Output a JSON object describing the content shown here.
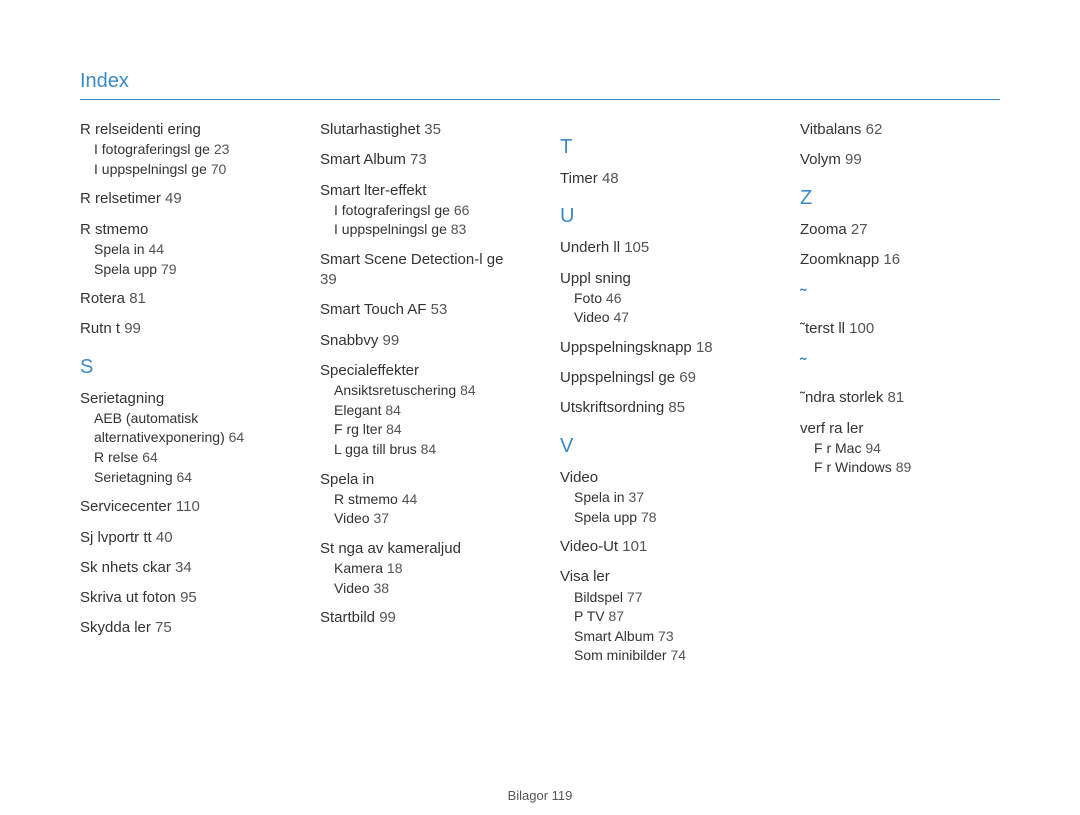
{
  "title": "Index",
  "footer_label": "Bilagor",
  "footer_page": "119",
  "columns": [
    {
      "blocks": [
        {
          "entries": [
            {
              "label": "R relseidenti ering",
              "subs": [
                {
                  "label": "I fotograferingsl ge",
                  "page": "23"
                },
                {
                  "label": "I uppspelningsl ge",
                  "page": "70"
                }
              ]
            },
            {
              "label": "R relsetimer",
              "page": "49"
            },
            {
              "label": "R stmemo",
              "subs": [
                {
                  "label": "Spela in",
                  "page": "44"
                },
                {
                  "label": "Spela upp",
                  "page": "79"
                }
              ]
            },
            {
              "label": "Rotera",
              "page": "81"
            },
            {
              "label": "Rutn t",
              "page": "99"
            }
          ]
        },
        {
          "letter": "S",
          "entries": [
            {
              "label": "Serietagning",
              "subs": [
                {
                  "label": "AEB (automatisk alternativexponering)",
                  "page": "64"
                },
                {
                  "label": "R relse",
                  "page": "64"
                },
                {
                  "label": "Serietagning",
                  "page": "64"
                }
              ]
            },
            {
              "label": "Servicecenter",
              "page": "110"
            },
            {
              "label": "Sj lvportr tt",
              "page": "40"
            },
            {
              "label": "Sk nhets ckar",
              "page": "34"
            },
            {
              "label": "Skriva ut foton",
              "page": "95"
            },
            {
              "label": "Skydda  ler",
              "page": "75"
            }
          ]
        }
      ]
    },
    {
      "blocks": [
        {
          "entries": [
            {
              "label": "Slutarhastighet",
              "page": "35"
            },
            {
              "label": "Smart Album",
              "page": "73"
            },
            {
              "label": "Smart  lter-effekt",
              "subs": [
                {
                  "label": "I fotograferingsl ge",
                  "page": "66"
                },
                {
                  "label": "I uppspelningsl ge",
                  "page": "83"
                }
              ]
            },
            {
              "label": "Smart Scene Detection-l ge",
              "page": "39"
            },
            {
              "label": "Smart Touch AF",
              "page": "53"
            },
            {
              "label": "Snabbvy",
              "page": "99"
            },
            {
              "label": "Specialeffekter",
              "subs": [
                {
                  "label": "Ansiktsretuschering",
                  "page": "84"
                },
                {
                  "label": "Elegant",
                  "page": "84"
                },
                {
                  "label": "F rg lter",
                  "page": "84"
                },
                {
                  "label": "L gga till brus",
                  "page": "84"
                }
              ]
            },
            {
              "label": "Spela in",
              "subs": [
                {
                  "label": "R stmemo",
                  "page": "44"
                },
                {
                  "label": "Video",
                  "page": "37"
                }
              ]
            },
            {
              "label": "St nga av kameraljud",
              "subs": [
                {
                  "label": "Kamera",
                  "page": "18"
                },
                {
                  "label": "Video",
                  "page": "38"
                }
              ]
            },
            {
              "label": "Startbild",
              "page": "99"
            }
          ]
        }
      ]
    },
    {
      "blocks": [
        {
          "letter": "T",
          "entries": [
            {
              "label": "Timer",
              "page": "48"
            }
          ]
        },
        {
          "letter": "U",
          "entries": [
            {
              "label": "Underh ll",
              "page": "105"
            },
            {
              "label": "Uppl sning",
              "subs": [
                {
                  "label": "Foto",
                  "page": "46"
                },
                {
                  "label": "Video",
                  "page": "47"
                }
              ]
            },
            {
              "label": "Uppspelningsknapp",
              "page": "18"
            },
            {
              "label": "Uppspelningsl ge",
              "page": "69"
            },
            {
              "label": "Utskriftsordning",
              "page": "85"
            }
          ]
        },
        {
          "letter": "V",
          "entries": [
            {
              "label": "Video",
              "subs": [
                {
                  "label": "Spela in",
                  "page": "37"
                },
                {
                  "label": "Spela upp",
                  "page": "78"
                }
              ]
            },
            {
              "label": "Video-Ut",
              "page": "101"
            },
            {
              "label": "Visa  ler",
              "subs": [
                {
                  "label": "Bildspel",
                  "page": "77"
                },
                {
                  "label": "P  TV",
                  "page": "87"
                },
                {
                  "label": "Smart Album",
                  "page": "73"
                },
                {
                  "label": "Som minibilder",
                  "page": "74"
                }
              ]
            }
          ]
        }
      ]
    },
    {
      "blocks": [
        {
          "entries": [
            {
              "label": "Vitbalans",
              "page": "62"
            },
            {
              "label": "Volym",
              "page": "99"
            }
          ]
        },
        {
          "letter": "Z",
          "entries": [
            {
              "label": "Zooma",
              "page": "27"
            },
            {
              "label": "Zoomknapp",
              "page": "16"
            }
          ]
        },
        {
          "letter": "˜",
          "entries": [
            {
              "label": "˜terst ll",
              "page": "100"
            }
          ]
        },
        {
          "letter": "˜",
          "entries": [
            {
              "label": "˜ndra storlek",
              "page": "81"
            }
          ]
        },
        {
          "entries": [
            {
              "label": " verf ra  ler",
              "subs": [
                {
                  "label": "F r Mac",
                  "page": "94"
                },
                {
                  "label": "F r Windows",
                  "page": "89"
                }
              ]
            }
          ]
        }
      ]
    }
  ]
}
